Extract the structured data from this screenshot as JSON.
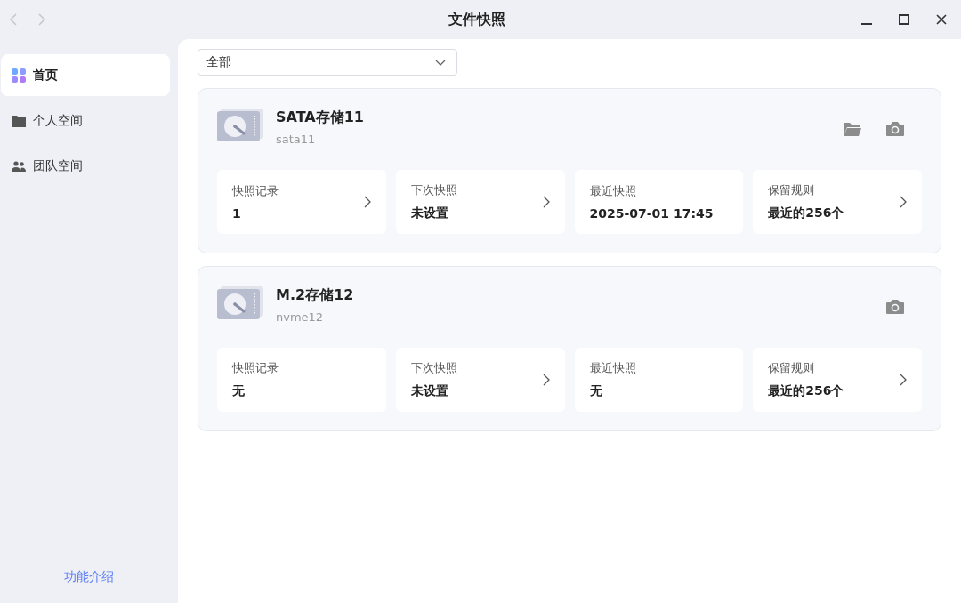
{
  "window": {
    "title": "文件快照",
    "back_disabled": true,
    "forward_disabled": true
  },
  "sidebar": {
    "items": [
      {
        "label": "首页",
        "kind": "grid",
        "selected": true
      },
      {
        "label": "个人空间",
        "kind": "folder",
        "selected": false
      },
      {
        "label": "团队空间",
        "kind": "people",
        "selected": false
      }
    ],
    "footer_link": "功能介绍"
  },
  "filter": {
    "value": "全部"
  },
  "volumes": [
    {
      "name": "SATA存储11",
      "device": "sata11",
      "actions": [
        {
          "kind": "folder"
        },
        {
          "kind": "camera"
        }
      ],
      "stats": [
        {
          "label": "快照记录",
          "value": "1",
          "link": true
        },
        {
          "label": "下次快照",
          "value": "未设置",
          "link": true
        },
        {
          "label": "最近快照",
          "value": "2025-07-01 17:45",
          "link": false
        },
        {
          "label": "保留规则",
          "value": "最近的256个",
          "link": true
        }
      ]
    },
    {
      "name": "M.2存储12",
      "device": "nvme12",
      "actions": [
        {
          "kind": "camera"
        }
      ],
      "stats": [
        {
          "label": "快照记录",
          "value": "无",
          "link": false
        },
        {
          "label": "下次快照",
          "value": "未设置",
          "link": true
        },
        {
          "label": "最近快照",
          "value": "无",
          "link": false
        },
        {
          "label": "保留规则",
          "value": "最近的256个",
          "link": true
        }
      ]
    }
  ]
}
